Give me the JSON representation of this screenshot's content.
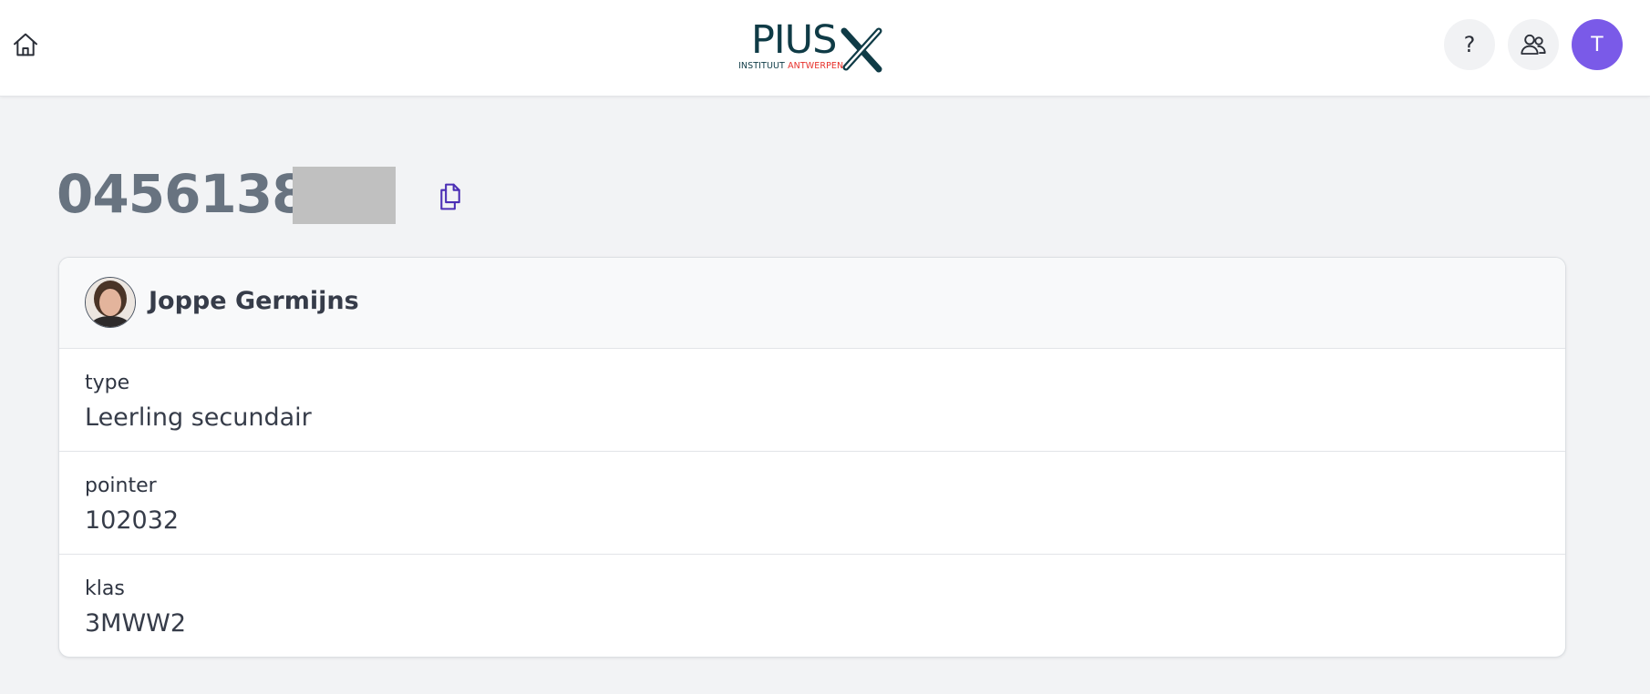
{
  "header": {
    "logo": {
      "main_text": "PIUS",
      "sub_text_part1": "INSTITUUT ",
      "sub_text_part2": "ANTWERPEN",
      "brand_dark": "#0f3b46",
      "brand_red": "#e7302a"
    },
    "home_icon": "home-icon",
    "help_label": "?",
    "users_icon": "users-icon",
    "avatar_initial": "T",
    "avatar_color": "#7a5ae8"
  },
  "record": {
    "id_visible": "0456138",
    "copy_icon": "copy-icon",
    "accent_color": "#4b2fb5"
  },
  "person": {
    "name": "Joppe Germijns",
    "fields": [
      {
        "label": "type",
        "value": "Leerling secundair"
      },
      {
        "label": "pointer",
        "value": "102032"
      },
      {
        "label": "klas",
        "value": "3MWW2"
      }
    ]
  }
}
